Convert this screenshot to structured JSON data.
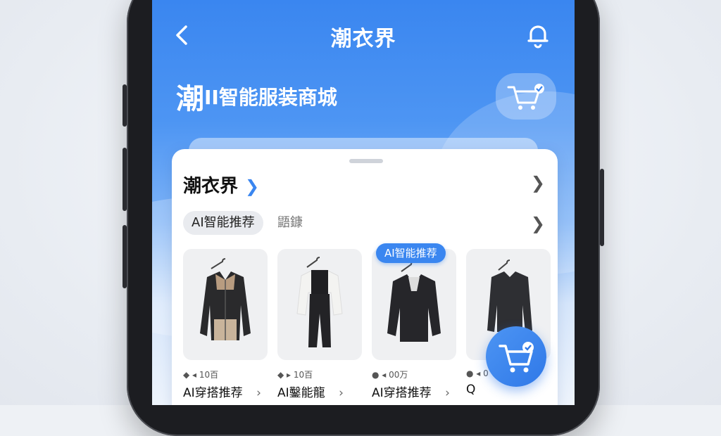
{
  "header": {
    "title": "潮衣界"
  },
  "brand": {
    "lead": "潮",
    "rest": "II智能服装商城"
  },
  "section": {
    "title": "潮衣界",
    "chip_active": "AI智能推荐",
    "chip_other": "鼯鏮"
  },
  "badge": {
    "label": "AI智能推荐"
  },
  "products": [
    {
      "meta": "◆ ◂ 10百",
      "caption": "AI穿搭推荐",
      "arrow": "›"
    },
    {
      "meta": "◆ ▸ 10百",
      "caption": "AI鑿能龍",
      "arrow": "›"
    },
    {
      "meta": "● ◂ 00万",
      "caption": "AI穿搭推荐",
      "arrow": "›"
    },
    {
      "meta": "● ◂ 0",
      "caption": "Q",
      "arrow": ""
    }
  ],
  "icons": {
    "back": "chevron-left-icon",
    "bell": "bell-icon",
    "cart": "shopping-cart-icon",
    "fab": "cart-check-icon"
  },
  "colors": {
    "accent": "#3a86f0"
  }
}
